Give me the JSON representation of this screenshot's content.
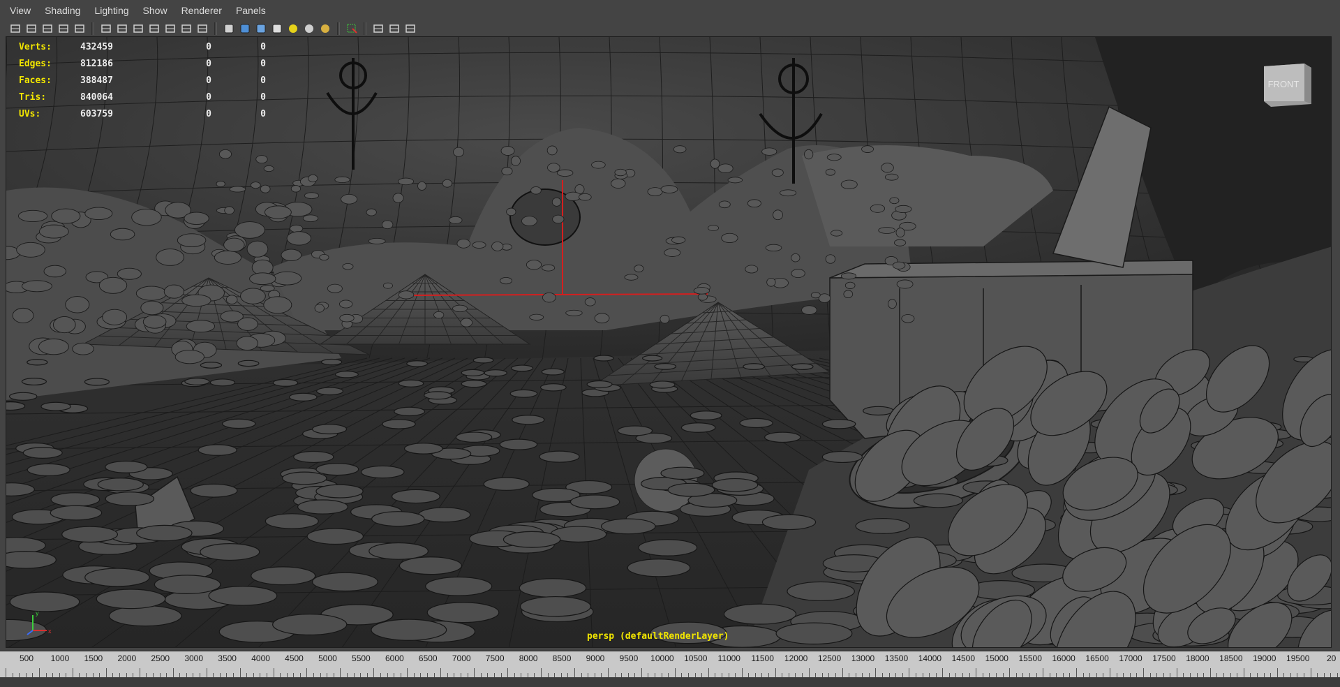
{
  "menu": [
    "View",
    "Shading",
    "Lighting",
    "Show",
    "Renderer",
    "Panels"
  ],
  "toolbar": {
    "groups": [
      [
        "camera-select-icon",
        "camera-attributes-icon",
        "bookmark-icon",
        "image-plane-icon",
        "two-d-pan-zoom-icon"
      ],
      [
        "grid-icon",
        "film-gate-icon",
        "resolution-gate-icon",
        "gate-mask-icon",
        "field-chart-icon",
        "safe-action-icon",
        "safe-title-icon"
      ],
      [
        "wireframe-icon",
        "smooth-shade-icon",
        "wireframe-on-shaded-icon",
        "textured-icon",
        "use-all-lights-icon",
        "shadows-icon",
        "ambient-occlusion-icon"
      ],
      [
        "select-camera-icon"
      ],
      [
        "isolate-select-icon",
        "xray-icon",
        "xray-joints-icon"
      ]
    ]
  },
  "hud": {
    "rows": [
      {
        "label": "Verts:",
        "value": "432459",
        "a": "0",
        "b": "0"
      },
      {
        "label": "Edges:",
        "value": "812186",
        "a": "0",
        "b": "0"
      },
      {
        "label": "Faces:",
        "value": "388487",
        "a": "0",
        "b": "0"
      },
      {
        "label": "Tris:",
        "value": "840064",
        "a": "0",
        "b": "0"
      },
      {
        "label": "UVs:",
        "value": "603759",
        "a": "0",
        "b": "0"
      }
    ]
  },
  "viewcube": {
    "face_label": "FRONT"
  },
  "camera_label": "persp (defaultRenderLayer)",
  "axis_labels": {
    "y": "y",
    "x": "x"
  },
  "timeline": {
    "labels": [
      "500",
      "1000",
      "1500",
      "2000",
      "2500",
      "3000",
      "3500",
      "4000",
      "4500",
      "5000",
      "5500",
      "6000",
      "6500",
      "7000",
      "7500",
      "8000",
      "8500",
      "9000",
      "9500",
      "10000",
      "10500",
      "11000",
      "11500",
      "12000",
      "12500",
      "13000",
      "13500",
      "14000",
      "14500",
      "15000",
      "15500",
      "16000",
      "16500",
      "17000",
      "17500",
      "18000",
      "18500",
      "19000",
      "19500",
      "20"
    ]
  },
  "colors": {
    "hud_label": "#f2e600",
    "hud_value": "#ececec",
    "manipulator": "#d41f1f",
    "background": "#444444",
    "viewport": "#2e2e2e",
    "timeline": "#c9c9c9"
  }
}
